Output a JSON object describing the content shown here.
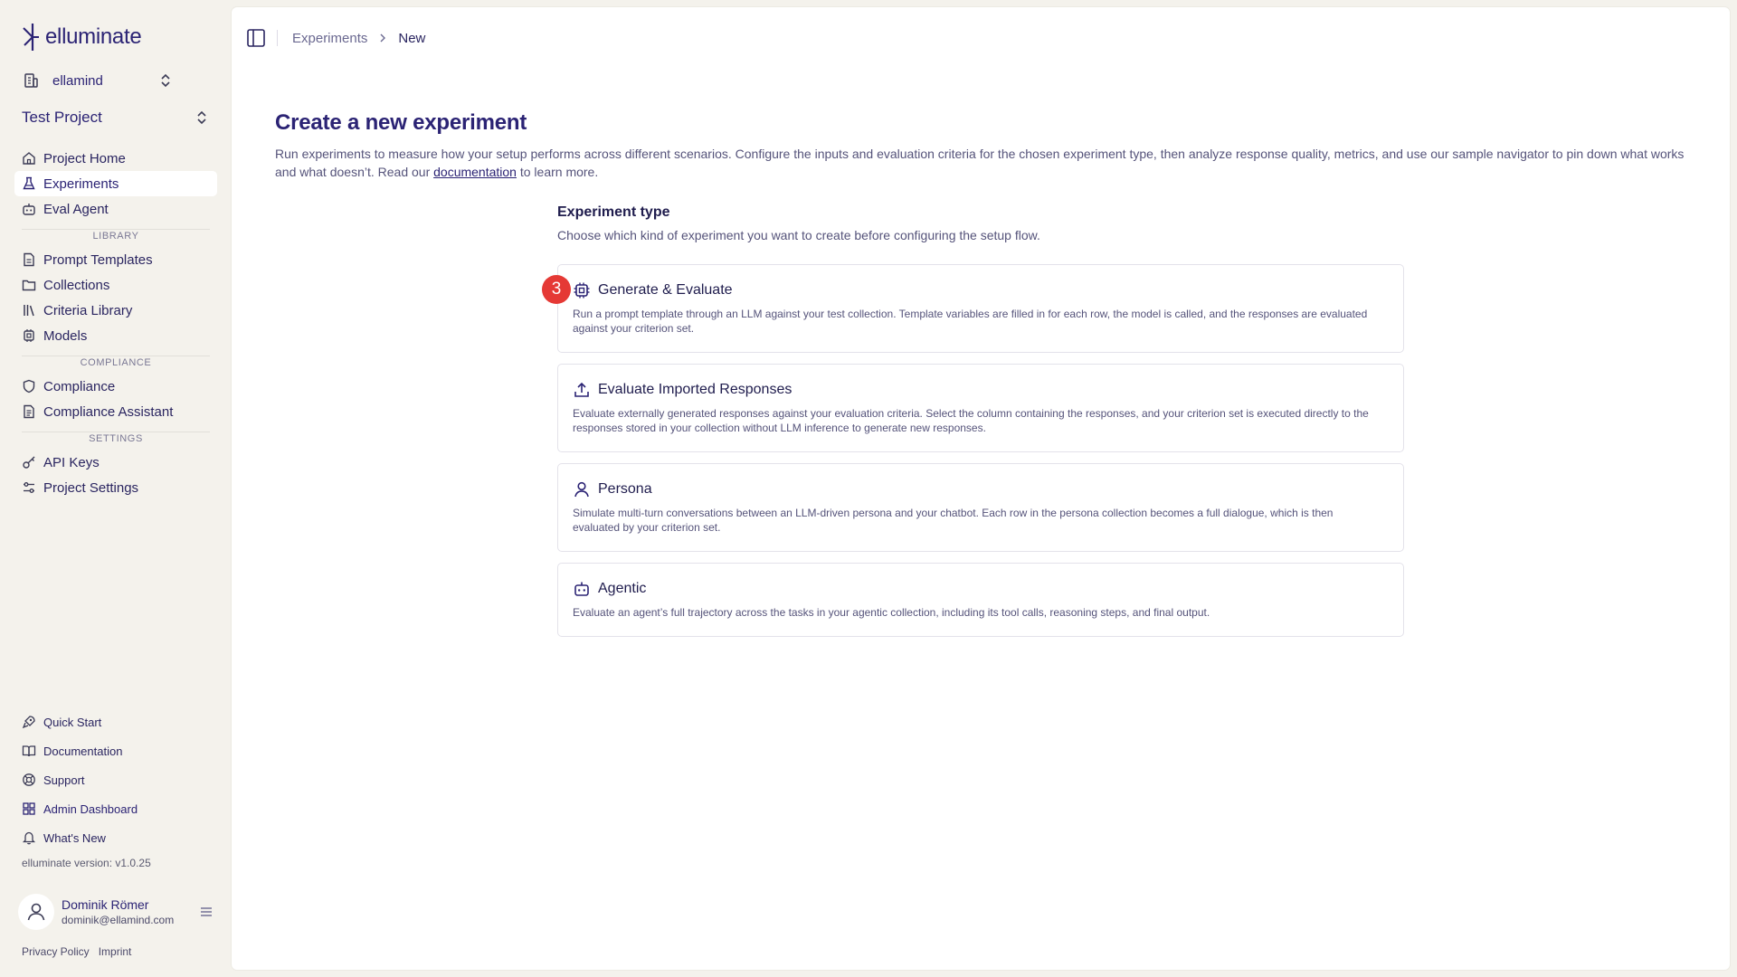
{
  "brand": {
    "name": "elluminate",
    "accent": "#2b2374"
  },
  "org": {
    "name": "ellamind"
  },
  "project": {
    "name": "Test Project"
  },
  "nav": {
    "main": [
      {
        "label": "Project Home",
        "icon": "home-icon"
      },
      {
        "label": "Experiments",
        "icon": "flask-icon",
        "active": true
      },
      {
        "label": "Eval Agent",
        "icon": "bot-icon"
      }
    ],
    "library_label": "LIBRARY",
    "library": [
      {
        "label": "Prompt Templates",
        "icon": "file-text-icon"
      },
      {
        "label": "Collections",
        "icon": "folder-icon"
      },
      {
        "label": "Criteria Library",
        "icon": "library-icon"
      },
      {
        "label": "Models",
        "icon": "cpu-icon"
      }
    ],
    "compliance_label": "COMPLIANCE",
    "compliance": [
      {
        "label": "Compliance",
        "icon": "shield-icon"
      },
      {
        "label": "Compliance Assistant",
        "icon": "file-check-icon"
      }
    ],
    "settings_label": "SETTINGS",
    "settings": [
      {
        "label": "API Keys",
        "icon": "key-icon"
      },
      {
        "label": "Project Settings",
        "icon": "sliders-icon"
      }
    ]
  },
  "bottom_nav": [
    {
      "label": "Quick Start",
      "icon": "rocket-icon"
    },
    {
      "label": "Documentation",
      "icon": "book-icon"
    },
    {
      "label": "Support",
      "icon": "lifebuoy-icon"
    },
    {
      "label": "Admin Dashboard",
      "icon": "dashboard-icon"
    },
    {
      "label": "What's New",
      "icon": "bell-icon"
    }
  ],
  "version": "elluminate version: v1.0.25",
  "user": {
    "name": "Dominik Römer",
    "email": "dominik@ellamind.com"
  },
  "legal": {
    "privacy": "Privacy Policy",
    "imprint": "Imprint"
  },
  "breadcrumb": {
    "parent": "Experiments",
    "current": "New"
  },
  "page": {
    "title": "Create a new experiment",
    "desc_before": "Run experiments to measure how your setup performs across different scenarios. Configure the inputs and evaluation criteria for the chosen experiment type, then analyze response quality, metrics, and use our sample navigator to pin down what works and what doesn’t. Read our ",
    "desc_link": "documentation",
    "desc_after": " to learn more."
  },
  "experiment_type": {
    "heading": "Experiment type",
    "subheading": "Choose which kind of experiment you want to create before configuring the setup flow.",
    "badge": "3",
    "options": [
      {
        "title": "Generate & Evaluate",
        "icon": "cpu-icon",
        "desc": "Run a prompt template through an LLM against your test collection. Template variables are filled in for each row, the model is called, and the responses are evaluated against your criterion set."
      },
      {
        "title": "Evaluate Imported Responses",
        "icon": "upload-icon",
        "desc": "Evaluate externally generated responses against your evaluation criteria. Select the column containing the responses, and your criterion set is executed directly to the responses stored in your collection without LLM inference to generate new responses."
      },
      {
        "title": "Persona",
        "icon": "user-icon",
        "desc": "Simulate multi-turn conversations between an LLM-driven persona and your chatbot. Each row in the persona collection becomes a full dialogue, which is then evaluated by your criterion set."
      },
      {
        "title": "Agentic",
        "icon": "bot-icon",
        "desc": "Evaluate an agent’s full trajectory across the tasks in your agentic collection, including its tool calls, reasoning steps, and final output."
      }
    ]
  }
}
